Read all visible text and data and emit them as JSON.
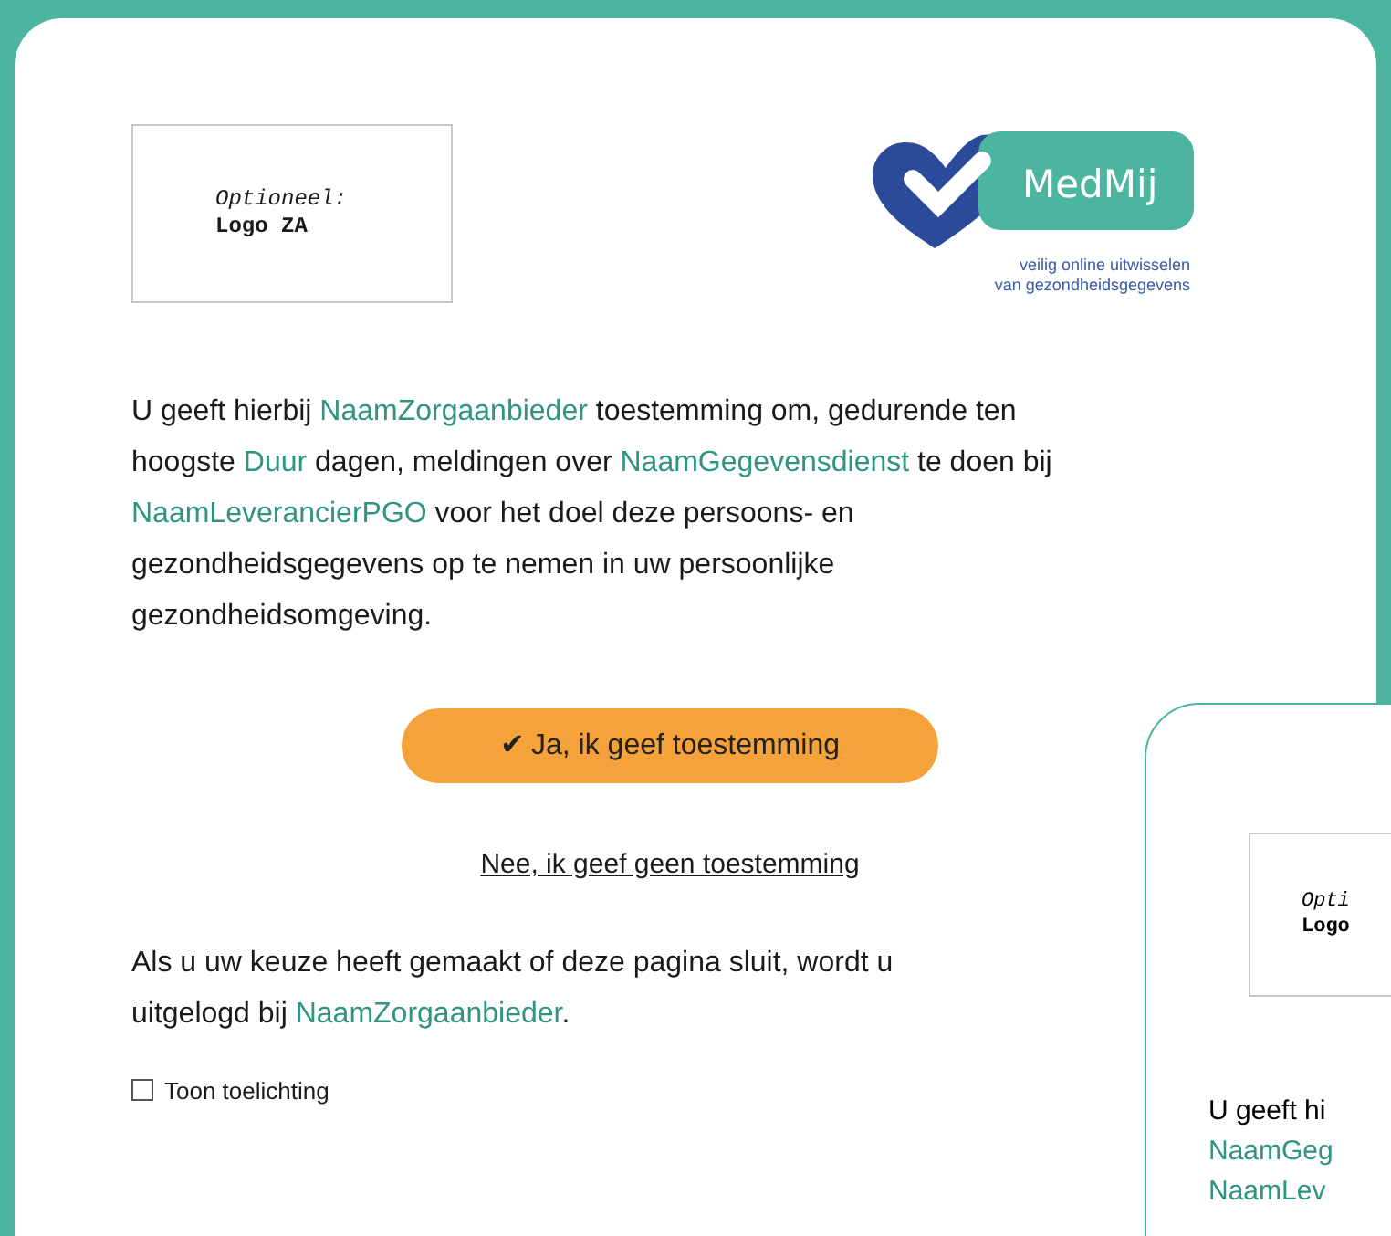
{
  "placeholder_logo": {
    "lines": [
      {
        "text": "Optioneel:",
        "italic": true
      },
      {
        "text": "Logo ZA",
        "italic": false
      }
    ]
  },
  "brand_logo": {
    "name": "MedMij",
    "tagline": [
      "veilig online uitwisselen",
      "van gezondheidsgegevens"
    ]
  },
  "consent_text": [
    {
      "kind": "plain",
      "text": "U geeft hierbij "
    },
    {
      "kind": "variable",
      "text": "NaamZorgaanbieder"
    },
    {
      "kind": "plain",
      "text": " toestemming om, gedurende ten hoogste "
    },
    {
      "kind": "variable",
      "text": "Duur"
    },
    {
      "kind": "plain",
      "text": " dagen, meldingen over "
    },
    {
      "kind": "variable",
      "text": "NaamGegevensdienst"
    },
    {
      "kind": "plain",
      "text": " te doen bij "
    },
    {
      "kind": "variable",
      "text": "NaamLeverancierPGO"
    },
    {
      "kind": "plain",
      "text": " voor het doel deze persoons- en gezondheidsgegevens op te nemen in uw persoonlijke gezondheidsomgeving."
    }
  ],
  "accept_button": {
    "icon": "✔",
    "label": "Ja, ik geef toestemming"
  },
  "decline_link": "Nee, ik geef geen toestemming",
  "logout_text": [
    {
      "kind": "plain",
      "text": "Als u uw keuze heeft gemaakt of deze pagina sluit, wordt u uitgelogd bij "
    },
    {
      "kind": "variable",
      "text": "NaamZorgaanbieder"
    },
    {
      "kind": "plain",
      "text": "."
    }
  ],
  "explanation_toggle": {
    "label": "Toon toelichting",
    "checked": false
  },
  "second_screen": {
    "logo_lines": [
      "Opti",
      "Logo"
    ],
    "text_lines": [
      {
        "kind": "plain",
        "text": "U geeft hi"
      },
      {
        "kind": "variable",
        "text": "NaamGeg"
      },
      {
        "kind": "variable",
        "text": "NaamLev"
      }
    ]
  }
}
